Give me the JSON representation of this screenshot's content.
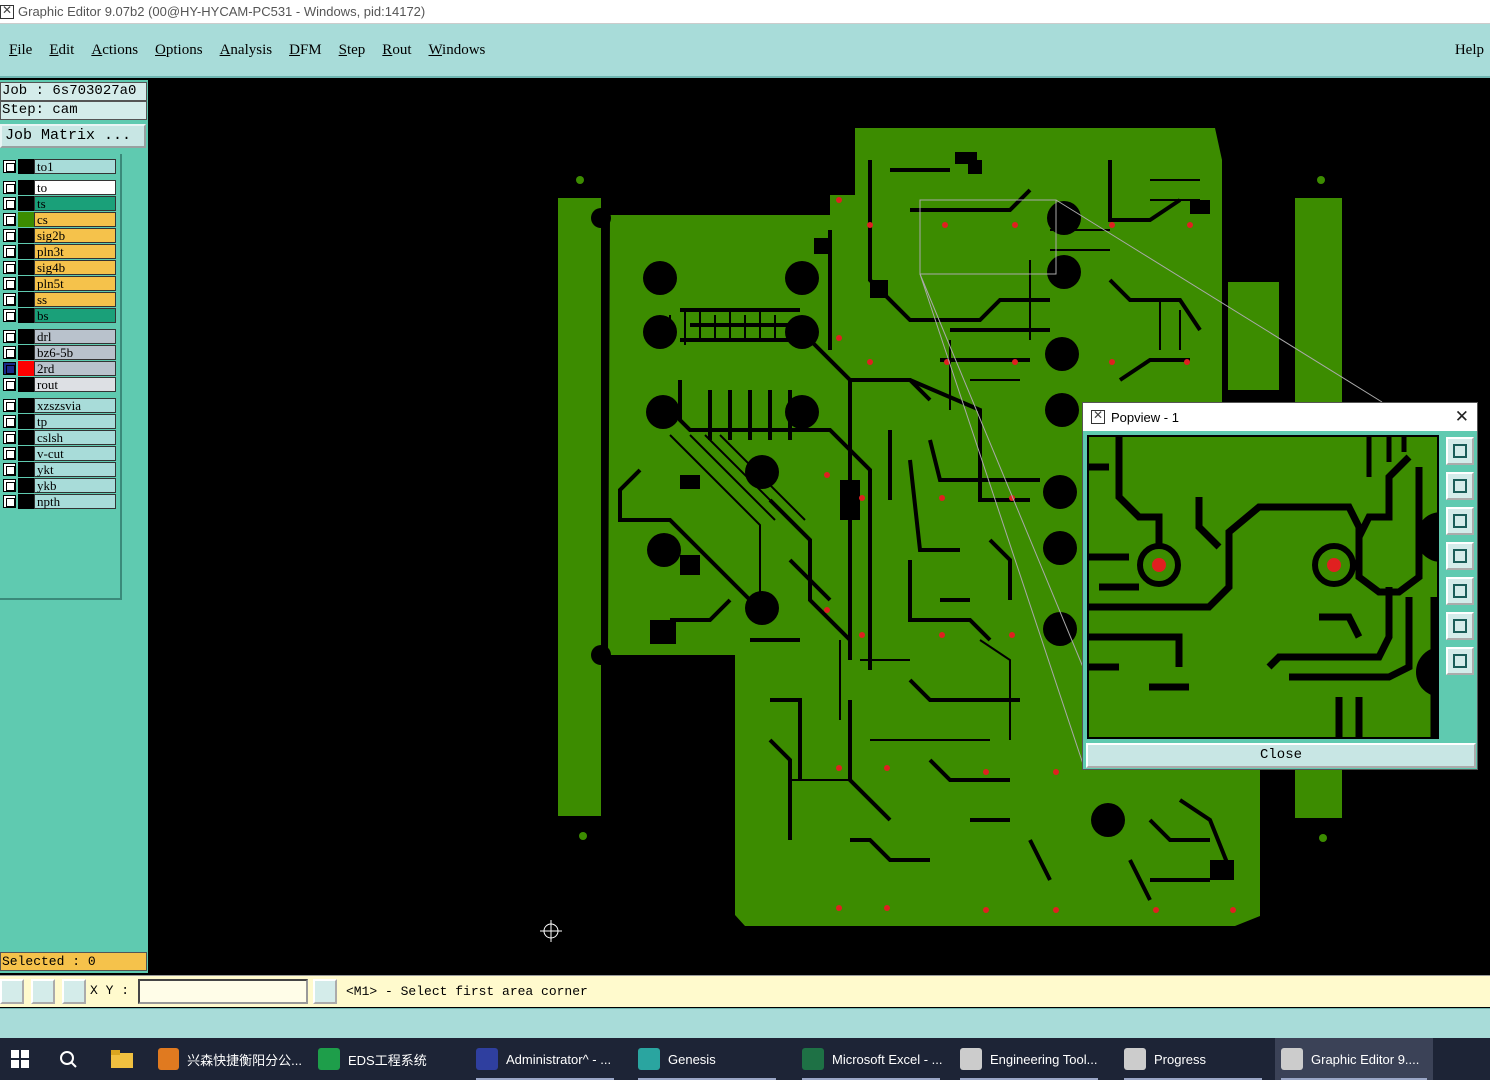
{
  "window": {
    "title": "Graphic Editor 9.07b2 (00@HY-HYCAM-PC531 - Windows, pid:14172)"
  },
  "menubar": {
    "items": [
      "File",
      "Edit",
      "Actions",
      "Options",
      "Analysis",
      "DFM",
      "Step",
      "Rout",
      "Windows"
    ],
    "help": "Help"
  },
  "left": {
    "job": "Job : 6s703027a0",
    "step": "Step: cam",
    "job_matrix": "Job Matrix ...",
    "layers": [
      {
        "name": "to1",
        "color": "#a8dcd9",
        "swatch": "#000000"
      },
      {
        "name": "to",
        "color": "#ffffff",
        "swatch": "#000000"
      },
      {
        "name": "ts",
        "color": "#1aa079",
        "swatch": "#000000"
      },
      {
        "name": "cs",
        "color": "#f5c24b",
        "swatch": "#3c8c00"
      },
      {
        "name": "sig2b",
        "color": "#f5c24b",
        "swatch": "#000000"
      },
      {
        "name": "pln3t",
        "color": "#f5c24b",
        "swatch": "#000000"
      },
      {
        "name": "sig4b",
        "color": "#f5c24b",
        "swatch": "#000000"
      },
      {
        "name": "pln5t",
        "color": "#f5c24b",
        "swatch": "#000000"
      },
      {
        "name": "ss",
        "color": "#f5c24b",
        "swatch": "#000000"
      },
      {
        "name": "bs",
        "color": "#1aa079",
        "swatch": "#000000"
      },
      {
        "name": "drl",
        "color": "#b9c2cc",
        "swatch": "#000000"
      },
      {
        "name": "bz6-5b",
        "color": "#b9c2cc",
        "swatch": "#000000"
      },
      {
        "name": "2rd",
        "color": "#b9c2cc",
        "swatch": "#ff0000"
      },
      {
        "name": "rout",
        "color": "#dde0e4",
        "swatch": "#000000"
      },
      {
        "name": "xzszsvia",
        "color": "#a8dcd9",
        "swatch": "#000000"
      },
      {
        "name": "tp",
        "color": "#a8dcd9",
        "swatch": "#000000"
      },
      {
        "name": "cslsh",
        "color": "#a8dcd9",
        "swatch": "#000000"
      },
      {
        "name": "v-cut",
        "color": "#a8dcd9",
        "swatch": "#000000"
      },
      {
        "name": "ykt",
        "color": "#a8dcd9",
        "swatch": "#000000"
      },
      {
        "name": "ykb",
        "color": "#a8dcd9",
        "swatch": "#000000"
      },
      {
        "name": "npth",
        "color": "#a8dcd9",
        "swatch": "#000000"
      }
    ],
    "selected": "Selected : 0"
  },
  "command": {
    "xy_label": "X Y :",
    "xy_value": "",
    "prompt": "<M1> - Select first area corner"
  },
  "popview": {
    "title": "Popview - 1",
    "close_label": "Close"
  },
  "taskbar": {
    "items": [
      {
        "label": "兴森快捷衡阳分公...",
        "icon": "browser-icon",
        "color": "#e07a20"
      },
      {
        "label": "EDS工程系统",
        "icon": "eds-app-icon",
        "color": "#1e9e4a"
      },
      {
        "label": "Administrator^ - ...",
        "icon": "disk-icon",
        "color": "#2f3f9f"
      },
      {
        "label": "Genesis",
        "icon": "genesis-icon",
        "color": "#2aa5a0"
      },
      {
        "label": "Microsoft Excel - ...",
        "icon": "excel-icon",
        "color": "#1e7145"
      },
      {
        "label": "Engineering Tool...",
        "icon": "tool-icon",
        "color": "#cccccc"
      },
      {
        "label": "Progress",
        "icon": "progress-icon",
        "color": "#cccccc"
      },
      {
        "label": "Graphic Editor 9....",
        "icon": "graphic-editor-icon",
        "color": "#cccccc"
      }
    ]
  },
  "colors": {
    "board": "#3c8c00",
    "canvas_bg": "#000000",
    "panel": "#5fcab0",
    "menubar": "#a8dcd9",
    "pad": "#e02020"
  }
}
